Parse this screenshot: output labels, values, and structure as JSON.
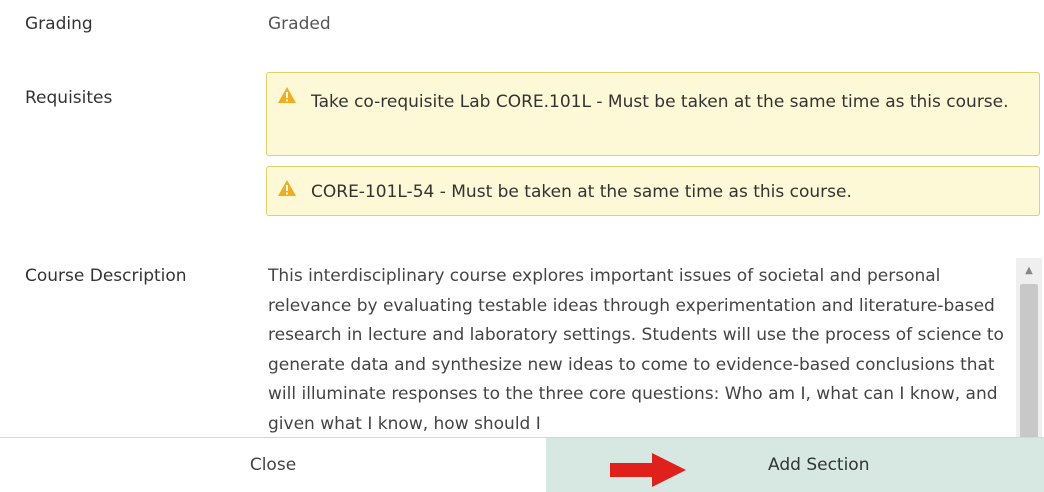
{
  "grading": {
    "label": "Grading",
    "value": "Graded"
  },
  "requisites": {
    "label": "Requisites",
    "items": [
      {
        "icon": "warning-icon",
        "text": "Take co-requisite Lab CORE.101L - Must be taken at the same time as this course."
      },
      {
        "icon": "warning-icon",
        "text": "CORE-101L-54 - Must be taken at the same time as this course."
      }
    ]
  },
  "description": {
    "label": "Course Description",
    "text": "This interdisciplinary course explores important issues of societal and personal relevance by evaluating testable ideas through experimentation and literature-based research in lecture and laboratory settings. Students will use the process of science to generate data and synthesize new ideas to come to evidence-based conclusions that will illuminate responses to the three core questions: Who am I, what can I know, and given what I know, how should I"
  },
  "footer": {
    "close_label": "Close",
    "add_section_label": "Add Section",
    "add_section_bg": "#d7e8e3",
    "arrow_color": "#e0201b"
  },
  "colors": {
    "warning_bg": "#fdf8d6",
    "warning_border": "#e3cf6c",
    "warning_icon": "#f0ad1e"
  }
}
